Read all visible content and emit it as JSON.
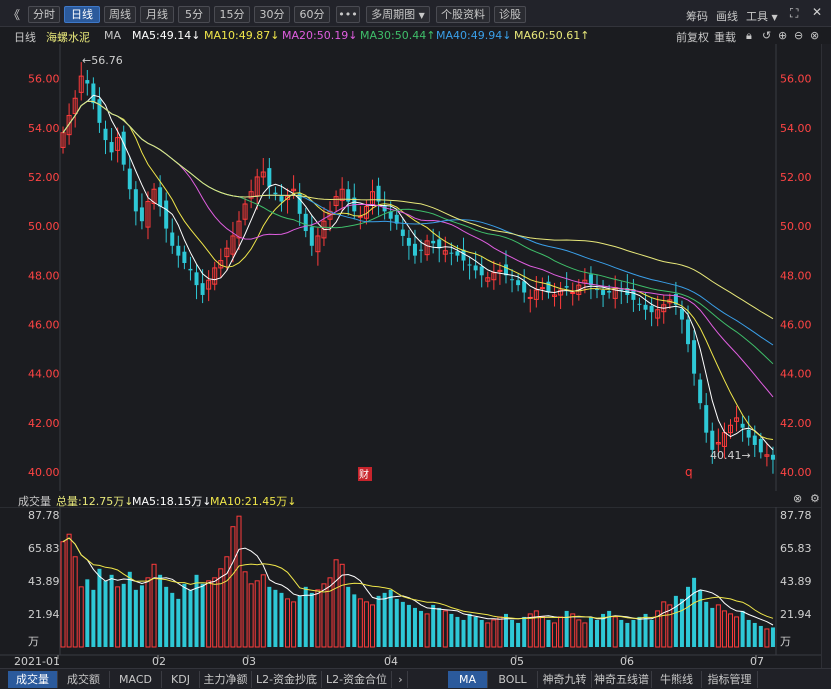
{
  "toolbar": {
    "back": "《",
    "tabs": [
      "分时",
      "日线",
      "周线",
      "月线",
      "5分",
      "15分",
      "30分",
      "60分"
    ],
    "active": "日线",
    "more": "•••",
    "multi": "多周期图",
    "stock_info": "个股资料",
    "diagnose": "诊股",
    "right": [
      "筹码",
      "画线",
      "工具"
    ]
  },
  "ma_bar": {
    "period": "日线",
    "stock": "海螺水泥",
    "ma": "MA",
    "ma5": "MA5:49.14↓",
    "ma10": "MA10:49.87↓",
    "ma20": "MA20:50.19↓",
    "ma30": "MA30:50.44↑",
    "ma40": "MA40:49.94↓",
    "ma60": "MA60:50.61↑",
    "adjust": "前复权",
    "reload": "重载"
  },
  "colors": {
    "up": "#ff3b3b",
    "down": "#2ec8d6",
    "ma5": "#ffffff",
    "ma10": "#f0e64a",
    "ma20": "#e05ee0",
    "ma30": "#3fbf6a",
    "ma40": "#3a9fe8",
    "ma60": "#e8e87a",
    "axis_price": "#ff4444"
  },
  "price_axis": [
    "56.00",
    "54.00",
    "52.00",
    "50.00",
    "48.00",
    "46.00",
    "44.00",
    "42.00",
    "40.00"
  ],
  "annotations": {
    "high": "56.76",
    "low": "40.41",
    "cai": "财",
    "q": "q"
  },
  "volume_bar": {
    "title": "成交量",
    "total": "总量:12.75万↓",
    "ma5": "MA5:18.15万↓",
    "ma10": "MA10:21.45万↓"
  },
  "volume_axis": [
    "87.78",
    "65.83",
    "43.89",
    "21.94",
    "万"
  ],
  "date_axis": [
    "2021-01",
    "02",
    "03",
    "04",
    "05",
    "06",
    "07"
  ],
  "bottom_tabs_left": [
    "成交量",
    "成交额",
    "MACD",
    "KDJ",
    "主力净额",
    "L2-资金抄底",
    "L2-资金合位"
  ],
  "bottom_tabs_right": [
    "MA",
    "BOLL",
    "神奇九转",
    "神奇五线谱",
    "牛熊线",
    "指标管理"
  ],
  "chart_data": {
    "type": "candlestick",
    "ylim": [
      40,
      57
    ],
    "days": 118,
    "close_series": [
      53.8,
      54.5,
      55.2,
      56.1,
      55.8,
      55.0,
      54.2,
      53.5,
      53.0,
      53.6,
      52.5,
      51.5,
      50.6,
      50.2,
      51.0,
      51.5,
      50.8,
      49.9,
      49.2,
      48.8,
      48.5,
      48.2,
      47.6,
      47.2,
      47.8,
      48.3,
      48.6,
      49.1,
      49.6,
      50.2,
      50.9,
      51.4,
      52.0,
      52.2,
      51.6,
      51.3,
      51.0,
      51.2,
      51.5,
      50.5,
      49.8,
      49.2,
      49.6,
      50.2,
      50.6,
      51.2,
      51.5,
      51.0,
      50.6,
      50.4,
      50.8,
      51.4,
      51.0,
      50.6,
      50.3,
      50.1,
      49.6,
      49.2,
      48.8,
      49.0,
      49.4,
      49.3,
      49.1,
      49.0,
      48.9,
      48.8,
      48.6,
      48.4,
      48.2,
      48.0,
      47.9,
      48.1,
      48.2,
      48.0,
      47.8,
      47.6,
      47.3,
      47.1,
      47.4,
      47.5,
      47.3,
      47.2,
      47.4,
      47.5,
      47.3,
      47.6,
      47.8,
      47.6,
      47.4,
      47.2,
      47.3,
      47.5,
      47.4,
      47.2,
      47.0,
      46.8,
      46.6,
      46.5,
      46.6,
      46.8,
      47.0,
      46.8,
      46.2,
      45.2,
      44.0,
      42.8,
      41.6,
      40.9,
      41.2,
      41.6,
      41.9,
      42.2,
      41.8,
      41.4,
      41.1,
      40.8,
      40.7,
      40.5
    ],
    "volume_series": [
      70,
      75,
      60,
      40,
      45,
      38,
      52,
      44,
      48,
      40,
      42,
      50,
      38,
      41,
      46,
      55,
      48,
      40,
      36,
      32,
      42,
      38,
      48,
      42,
      44,
      46,
      52,
      60,
      80,
      87,
      50,
      42,
      44,
      48,
      40,
      38,
      36,
      32,
      30,
      34,
      40,
      36,
      38,
      42,
      46,
      58,
      55,
      40,
      35,
      32,
      30,
      28,
      34,
      36,
      38,
      32,
      30,
      28,
      26,
      24,
      22,
      28,
      26,
      24,
      22,
      20,
      18,
      22,
      20,
      18,
      16,
      18,
      20,
      22,
      18,
      16,
      20,
      22,
      24,
      20,
      18,
      16,
      20,
      24,
      22,
      18,
      16,
      20,
      18,
      22,
      24,
      20,
      18,
      16,
      18,
      20,
      22,
      18,
      24,
      30,
      28,
      34,
      32,
      40,
      46,
      38,
      30,
      26,
      28,
      24,
      22,
      20,
      24,
      18,
      16,
      14,
      12,
      13
    ]
  }
}
